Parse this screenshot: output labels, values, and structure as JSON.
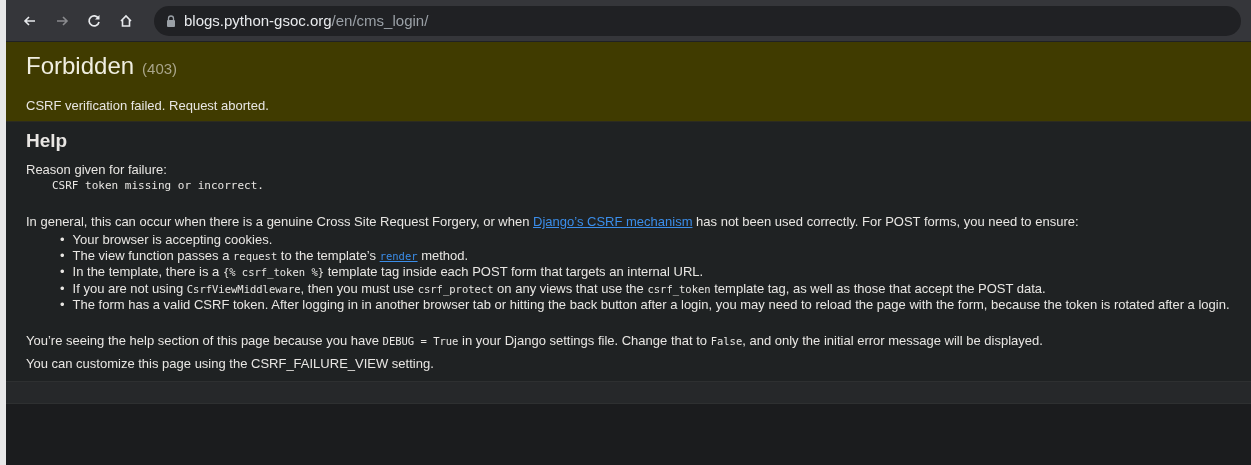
{
  "browser": {
    "nav_buttons": [
      {
        "kind": "back",
        "disabled": false
      },
      {
        "kind": "forward",
        "disabled": true
      },
      {
        "kind": "reload",
        "disabled": false
      },
      {
        "kind": "home",
        "disabled": false
      }
    ],
    "url": {
      "host": "blogs.python-gsoc.org",
      "path": "/en/cms_login/"
    }
  },
  "error": {
    "title": "Forbidden",
    "code": "(403)",
    "message": "CSRF verification failed. Request aborted."
  },
  "help": {
    "heading": "Help",
    "reason_label": "Reason given for failure:",
    "reason": "CSRF token missing or incorrect.",
    "intro": [
      {
        "kind": "text",
        "text": "In general, this can occur when there is a genuine Cross Site Request Forgery, or when "
      },
      {
        "kind": "link",
        "text": "Django’s CSRF mechanism"
      },
      {
        "kind": "text",
        "text": " has not been used correctly. For POST forms, you need to ensure:"
      }
    ],
    "items": [
      {
        "bullet": "•",
        "parts": [
          {
            "kind": "text",
            "text": "Your browser is accepting cookies."
          }
        ]
      },
      {
        "bullet": "•",
        "parts": [
          {
            "kind": "text",
            "text": "The view function passes a "
          },
          {
            "kind": "code",
            "text": "request"
          },
          {
            "kind": "text",
            "text": " to the template’s "
          },
          {
            "kind": "codelink",
            "text": "render"
          },
          {
            "kind": "text",
            "text": " method."
          }
        ]
      },
      {
        "bullet": "•",
        "parts": [
          {
            "kind": "text",
            "text": "In the template, there is a "
          },
          {
            "kind": "code",
            "text": "{% csrf_token %}"
          },
          {
            "kind": "text",
            "text": " template tag inside each POST form that targets an internal URL."
          }
        ]
      },
      {
        "bullet": "•",
        "parts": [
          {
            "kind": "text",
            "text": "If you are not using "
          },
          {
            "kind": "code",
            "text": "CsrfViewMiddleware"
          },
          {
            "kind": "text",
            "text": ", then you must use "
          },
          {
            "kind": "code",
            "text": "csrf_protect"
          },
          {
            "kind": "text",
            "text": " on any views that use the "
          },
          {
            "kind": "code",
            "text": "csrf_token"
          },
          {
            "kind": "text",
            "text": " template tag, as well as those that accept the POST data."
          }
        ]
      },
      {
        "bullet": "•",
        "parts": [
          {
            "kind": "text",
            "text": "The form has a valid CSRF token. After logging in in another browser tab or hitting the back button after a login, you may need to reload the page with the form, because the token is rotated after a login."
          }
        ]
      }
    ],
    "notes": [
      [
        {
          "kind": "text",
          "text": "You’re seeing the help section of this page because you have "
        },
        {
          "kind": "code",
          "text": "DEBUG = True"
        },
        {
          "kind": "text",
          "text": " in your Django settings file. Change that to "
        },
        {
          "kind": "code",
          "text": "False"
        },
        {
          "kind": "text",
          "text": ", and only the initial error message will be displayed."
        }
      ],
      [
        {
          "kind": "text",
          "text": "You can customize this page using the CSRF_FAILURE_VIEW setting."
        }
      ]
    ]
  }
}
